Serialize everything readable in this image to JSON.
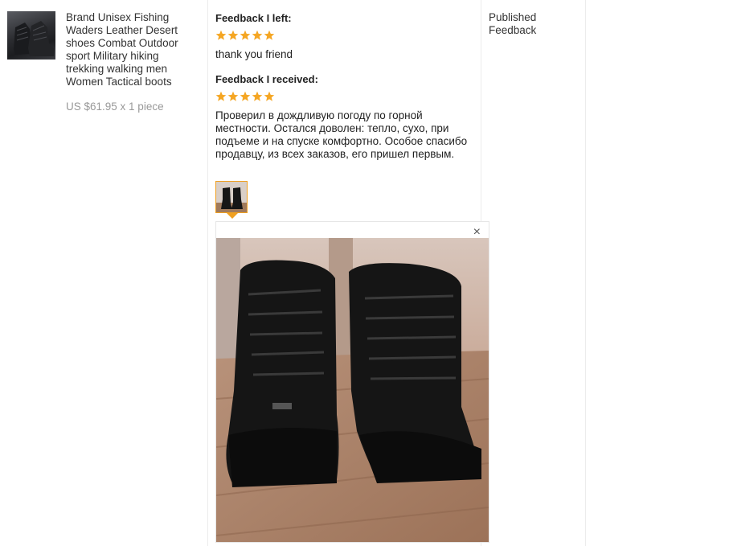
{
  "product": {
    "title": "Brand Unisex Fishing Waders Leather Desert shoes Combat Outdoor sport Military hiking trekking walking men Women Tactical boots",
    "price": "US $61.95 x 1 piece",
    "thumbnail_icon": "boot-product-image"
  },
  "feedback_left": {
    "heading": "Feedback I left:",
    "stars": 5,
    "text": "thank you friend"
  },
  "feedback_received": {
    "heading": "Feedback I received:",
    "stars": 5,
    "text": "Проверил в дождливую погоду по горной местности. Остался доволен: тепло, сухо, при подъеме и на спуске комфортно. Особое спасибо продавцу, из всех заказов, его пришел первым.",
    "photo_count": 1
  },
  "preview": {
    "close_label": "×"
  },
  "status": {
    "text": "Published Feedback"
  },
  "colors": {
    "star": "#f5a623",
    "thumb_border": "#f0a020",
    "price": "#999999"
  }
}
